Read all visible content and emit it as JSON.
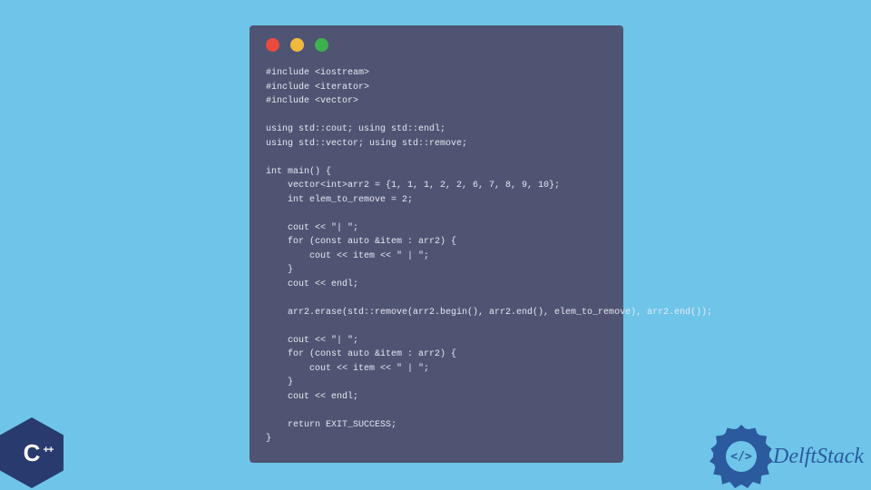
{
  "code": {
    "lines": [
      "#include <iostream>",
      "#include <iterator>",
      "#include <vector>",
      "",
      "using std::cout; using std::endl;",
      "using std::vector; using std::remove;",
      "",
      "int main() {",
      "    vector<int>arr2 = {1, 1, 1, 2, 2, 6, 7, 8, 9, 10};",
      "    int elem_to_remove = 2;",
      "",
      "    cout << \"| \";",
      "    for (const auto &item : arr2) {",
      "        cout << item << \" | \";",
      "    }",
      "    cout << endl;",
      "",
      "    arr2.erase(std::remove(arr2.begin(), arr2.end(), elem_to_remove), arr2.end());",
      "",
      "    cout << \"| \";",
      "    for (const auto &item : arr2) {",
      "        cout << item << \" | \";",
      "    }",
      "    cout << endl;",
      "",
      "    return EXIT_SUCCESS;",
      "}"
    ]
  },
  "cpp_logo": {
    "text": "C",
    "plus": "++"
  },
  "delft": {
    "brand": "DelftStack",
    "icon_text": "</>"
  }
}
